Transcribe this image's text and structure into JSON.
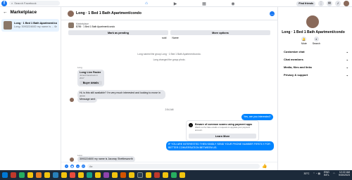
{
  "topbar": {
    "search_placeholder": "Search Facebook",
    "find_friends": "Find friends"
  },
  "left": {
    "title": "Marketplace",
    "item_title": "Long · 1 Bed 1 Bath Apartment/co...",
    "item_sub": "Long: 3093224600 my name is ... 6m"
  },
  "chat": {
    "title": "Long · 1 Bed 1 Bath Apartment/condo",
    "seller": "Marketplace",
    "listing": "$785 · 1 Bed 1 Bath Apartment/condo",
    "mark_pending": "Mark as pending",
    "more_options": "More options",
    "tag_sold": "sold",
    "tag_name": "Name",
    "sys1": "Long named the group Long · 1 Bed 1 Bath Apartment/condo.",
    "sys2": "Long changed the group photo.",
    "sender1": "Long",
    "card_title": "Long Live Faster",
    "card_sub": "Joined Facebook in 2017",
    "card_btn": "Buyer details",
    "msg1": "Hi, is this still available? I'm very much interested and looking to move in asap",
    "msg2": "Message sent",
    "time1": "2:54 AM",
    "out1": "Yes, are you interested?",
    "scam_title": "Beware of common scams using payment apps",
    "scam_sub": "Watch out for fake emails or requests to upgrade your payment account.",
    "scam_btn": "Learn More",
    "out2": "IF YOU ARE INTERESTED THEN KINDLY SEND YOUR PHONE NUMBER FIRSTLY FOR BETTER CONVERSATION BETWEEN US.",
    "sender2": "Long",
    "msg3": "3093224600 my name is Jacoray Shettlesworth",
    "composer_placeholder": "Aa"
  },
  "right": {
    "title": "Long · 1 Bed 1 Bath Apartment/condo",
    "mute": "Mute",
    "search": "Search",
    "menu1": "Customize chat",
    "menu2": "Chat members",
    "menu3": "Media, files and links",
    "menu4": "Privacy & support"
  },
  "taskbar": {
    "temp": "30°C",
    "lang": "ENG",
    "lang2": "INTL",
    "time": "12:22 AM",
    "date": "9/30/2023"
  }
}
